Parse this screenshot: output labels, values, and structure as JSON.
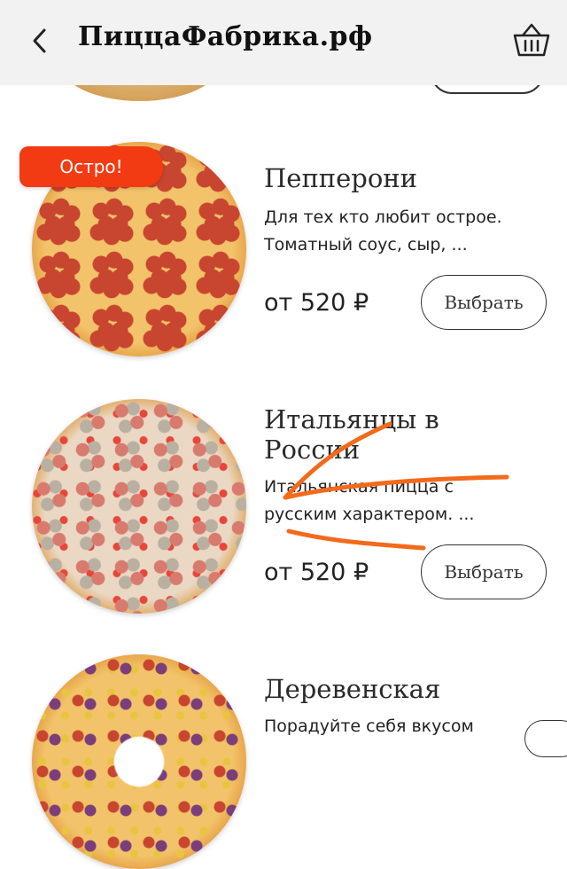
{
  "header": {
    "title": "ПиццаФабрика.рф",
    "back_icon": "chevron-left-icon",
    "cart_icon": "basket-icon"
  },
  "products": [
    {
      "name": "Пепперони",
      "badge": "Остро!",
      "desc_line1": "Для тех кто любит острое.",
      "desc_line2": "Томатный соус, сыр, ...",
      "price": "от 520 ₽",
      "button": "Выбрать"
    },
    {
      "name_line1": "Итальянцы в",
      "name_line2": "России",
      "desc_line1": "Итальянская пицца с",
      "desc_line2": "русским характером. ...",
      "price": "от 520 ₽",
      "button": "Выбрать"
    },
    {
      "name": "Деревенская",
      "desc_line1": "Порадуйте себя вкусом"
    }
  ],
  "colors": {
    "badge": "#f23b12",
    "header_bg": "#f2f2f2",
    "annotation": "#f26a1b"
  }
}
